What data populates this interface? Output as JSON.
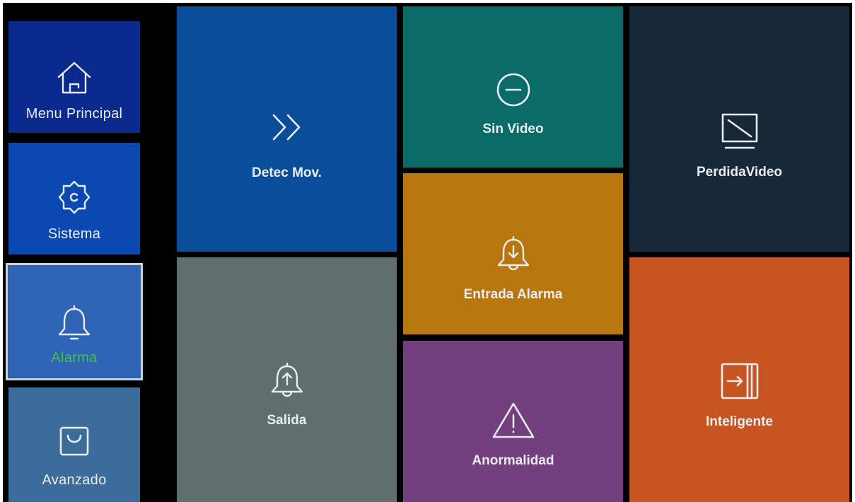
{
  "theme": {
    "label_color": "#e9edf2",
    "selected_label_color": "#3fc34a",
    "background": "#000000"
  },
  "sidebar": {
    "items": [
      {
        "label": "Menu Principal",
        "icon": "home-icon",
        "color": "#0a2a8e",
        "selected": false
      },
      {
        "label": "Sistema",
        "icon": "gear-icon",
        "color": "#0b48b2",
        "selected": false
      },
      {
        "label": "Alarma",
        "icon": "bell-icon",
        "color": "#2f63b4",
        "selected": true
      },
      {
        "label": "Avanzado",
        "icon": "shopping-bag-icon",
        "color": "#3c6c9a",
        "selected": false
      }
    ]
  },
  "tiles": {
    "motion": {
      "label": "Detec Mov.",
      "icon": "double-chevron-right-icon",
      "color": "#0a4d99"
    },
    "output": {
      "label": "Salida",
      "icon": "bell-arrow-up-icon",
      "color": "#5f6f6d"
    },
    "novideo": {
      "label": "Sin Video",
      "icon": "minus-circle-icon",
      "color": "#0b6b67"
    },
    "alarmin": {
      "label": "Entrada Alarma",
      "icon": "bell-arrow-down-icon",
      "color": "#b8760f"
    },
    "abnormal": {
      "label": "Anormalidad",
      "icon": "warning-triangle-icon",
      "color": "#733f7d"
    },
    "videoloss": {
      "label": "PerdidaVideo",
      "icon": "monitor-slash-icon",
      "color": "#172838"
    },
    "intelligent": {
      "label": "Inteligente",
      "icon": "enter-box-icon",
      "color": "#c75522"
    }
  }
}
